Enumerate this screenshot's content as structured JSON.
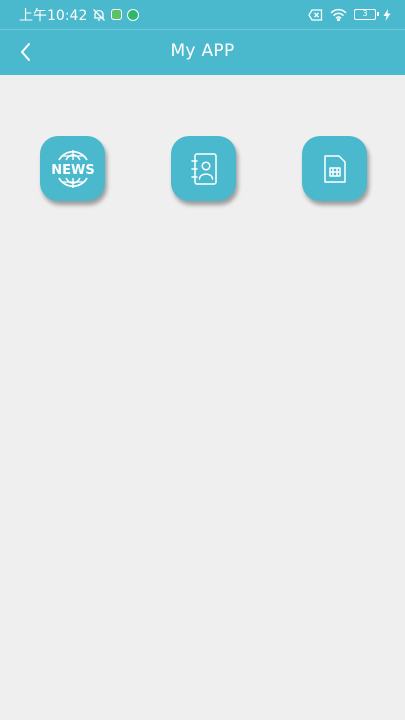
{
  "status_bar": {
    "time": "上午10:42",
    "icons": [
      "bell-muted-icon",
      "app-notification-icon",
      "shield-icon",
      "no-sim-icon",
      "wifi-icon",
      "battery-icon",
      "charging-icon"
    ],
    "battery_level": "3"
  },
  "header": {
    "title": "My APP",
    "back_icon": "chevron-left-icon"
  },
  "launcher": {
    "tiles": [
      {
        "icon": "news-globe-icon",
        "icon_text": "NEWS"
      },
      {
        "icon": "contacts-book-icon"
      },
      {
        "icon": "sim-card-icon"
      }
    ]
  },
  "colors": {
    "primary": "#4ab9cd",
    "background": "#efefef",
    "icon_foreground": "#ffffff"
  }
}
